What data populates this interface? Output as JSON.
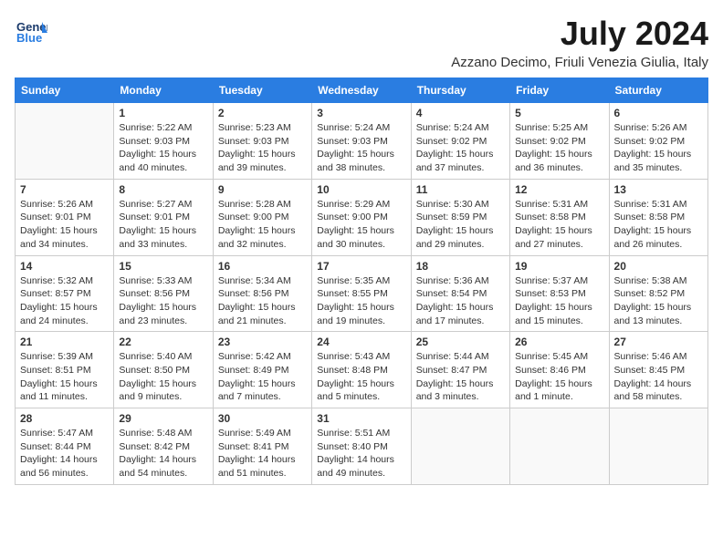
{
  "header": {
    "logo_general": "General",
    "logo_blue": "Blue",
    "month_year": "July 2024",
    "location": "Azzano Decimo, Friuli Venezia Giulia, Italy"
  },
  "days_of_week": [
    "Sunday",
    "Monday",
    "Tuesday",
    "Wednesday",
    "Thursday",
    "Friday",
    "Saturday"
  ],
  "weeks": [
    [
      {
        "day": "",
        "empty": true
      },
      {
        "day": "1",
        "sunrise": "5:22 AM",
        "sunset": "9:03 PM",
        "daylight": "15 hours and 40 minutes."
      },
      {
        "day": "2",
        "sunrise": "5:23 AM",
        "sunset": "9:03 PM",
        "daylight": "15 hours and 39 minutes."
      },
      {
        "day": "3",
        "sunrise": "5:24 AM",
        "sunset": "9:03 PM",
        "daylight": "15 hours and 38 minutes."
      },
      {
        "day": "4",
        "sunrise": "5:24 AM",
        "sunset": "9:02 PM",
        "daylight": "15 hours and 37 minutes."
      },
      {
        "day": "5",
        "sunrise": "5:25 AM",
        "sunset": "9:02 PM",
        "daylight": "15 hours and 36 minutes."
      },
      {
        "day": "6",
        "sunrise": "5:26 AM",
        "sunset": "9:02 PM",
        "daylight": "15 hours and 35 minutes."
      }
    ],
    [
      {
        "day": "7",
        "sunrise": "5:26 AM",
        "sunset": "9:01 PM",
        "daylight": "15 hours and 34 minutes."
      },
      {
        "day": "8",
        "sunrise": "5:27 AM",
        "sunset": "9:01 PM",
        "daylight": "15 hours and 33 minutes."
      },
      {
        "day": "9",
        "sunrise": "5:28 AM",
        "sunset": "9:00 PM",
        "daylight": "15 hours and 32 minutes."
      },
      {
        "day": "10",
        "sunrise": "5:29 AM",
        "sunset": "9:00 PM",
        "daylight": "15 hours and 30 minutes."
      },
      {
        "day": "11",
        "sunrise": "5:30 AM",
        "sunset": "8:59 PM",
        "daylight": "15 hours and 29 minutes."
      },
      {
        "day": "12",
        "sunrise": "5:31 AM",
        "sunset": "8:58 PM",
        "daylight": "15 hours and 27 minutes."
      },
      {
        "day": "13",
        "sunrise": "5:31 AM",
        "sunset": "8:58 PM",
        "daylight": "15 hours and 26 minutes."
      }
    ],
    [
      {
        "day": "14",
        "sunrise": "5:32 AM",
        "sunset": "8:57 PM",
        "daylight": "15 hours and 24 minutes."
      },
      {
        "day": "15",
        "sunrise": "5:33 AM",
        "sunset": "8:56 PM",
        "daylight": "15 hours and 23 minutes."
      },
      {
        "day": "16",
        "sunrise": "5:34 AM",
        "sunset": "8:56 PM",
        "daylight": "15 hours and 21 minutes."
      },
      {
        "day": "17",
        "sunrise": "5:35 AM",
        "sunset": "8:55 PM",
        "daylight": "15 hours and 19 minutes."
      },
      {
        "day": "18",
        "sunrise": "5:36 AM",
        "sunset": "8:54 PM",
        "daylight": "15 hours and 17 minutes."
      },
      {
        "day": "19",
        "sunrise": "5:37 AM",
        "sunset": "8:53 PM",
        "daylight": "15 hours and 15 minutes."
      },
      {
        "day": "20",
        "sunrise": "5:38 AM",
        "sunset": "8:52 PM",
        "daylight": "15 hours and 13 minutes."
      }
    ],
    [
      {
        "day": "21",
        "sunrise": "5:39 AM",
        "sunset": "8:51 PM",
        "daylight": "15 hours and 11 minutes."
      },
      {
        "day": "22",
        "sunrise": "5:40 AM",
        "sunset": "8:50 PM",
        "daylight": "15 hours and 9 minutes."
      },
      {
        "day": "23",
        "sunrise": "5:42 AM",
        "sunset": "8:49 PM",
        "daylight": "15 hours and 7 minutes."
      },
      {
        "day": "24",
        "sunrise": "5:43 AM",
        "sunset": "8:48 PM",
        "daylight": "15 hours and 5 minutes."
      },
      {
        "day": "25",
        "sunrise": "5:44 AM",
        "sunset": "8:47 PM",
        "daylight": "15 hours and 3 minutes."
      },
      {
        "day": "26",
        "sunrise": "5:45 AM",
        "sunset": "8:46 PM",
        "daylight": "15 hours and 1 minute."
      },
      {
        "day": "27",
        "sunrise": "5:46 AM",
        "sunset": "8:45 PM",
        "daylight": "14 hours and 58 minutes."
      }
    ],
    [
      {
        "day": "28",
        "sunrise": "5:47 AM",
        "sunset": "8:44 PM",
        "daylight": "14 hours and 56 minutes."
      },
      {
        "day": "29",
        "sunrise": "5:48 AM",
        "sunset": "8:42 PM",
        "daylight": "14 hours and 54 minutes."
      },
      {
        "day": "30",
        "sunrise": "5:49 AM",
        "sunset": "8:41 PM",
        "daylight": "14 hours and 51 minutes."
      },
      {
        "day": "31",
        "sunrise": "5:51 AM",
        "sunset": "8:40 PM",
        "daylight": "14 hours and 49 minutes."
      },
      {
        "day": "",
        "empty": true
      },
      {
        "day": "",
        "empty": true
      },
      {
        "day": "",
        "empty": true
      }
    ]
  ],
  "labels": {
    "sunrise_prefix": "Sunrise: ",
    "sunset_prefix": "Sunset: ",
    "daylight_prefix": "Daylight: "
  }
}
